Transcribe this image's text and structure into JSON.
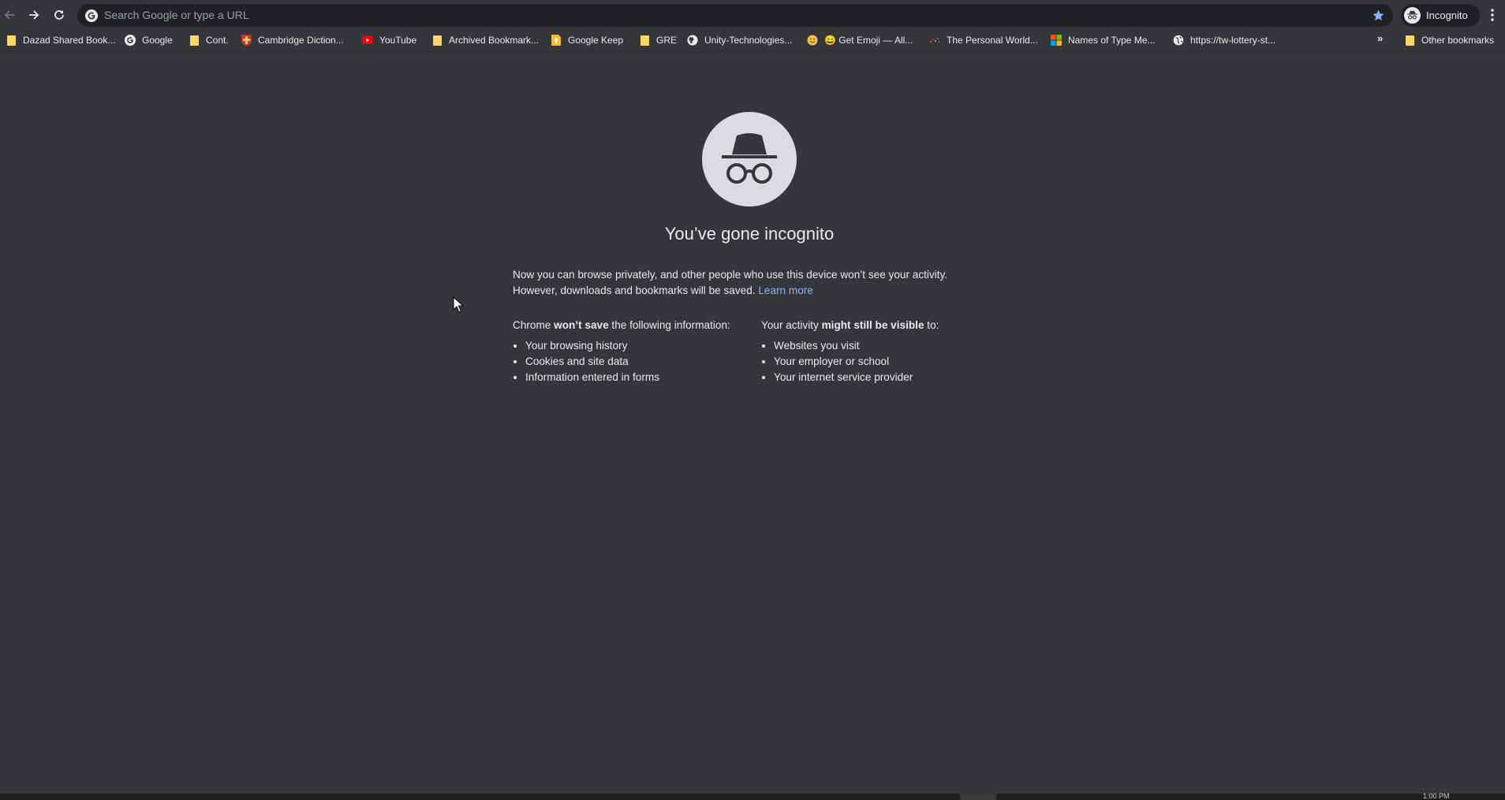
{
  "omnibox": {
    "placeholder": "Search Google or type a URL"
  },
  "profile": {
    "label": "Incognito"
  },
  "bookmarks": [
    {
      "label": "Dazad Shared Book...",
      "icon": "folder-icon"
    },
    {
      "label": "Google",
      "icon": "google-icon"
    },
    {
      "label": "Cont.",
      "icon": "folder-icon"
    },
    {
      "label": "Cambridge Diction...",
      "icon": "cambridge-icon"
    },
    {
      "label": "YouTube",
      "icon": "youtube-icon"
    },
    {
      "label": "Archived Bookmark...",
      "icon": "folder-icon"
    },
    {
      "label": "Google Keep",
      "icon": "google-keep-icon"
    },
    {
      "label": "GRE",
      "icon": "folder-icon"
    },
    {
      "label": "Unity-Technologies...",
      "icon": "github-icon"
    },
    {
      "label": "😄 Get Emoji — All...",
      "icon": "emoji-icon"
    },
    {
      "label": "The Personal World...",
      "icon": "personal-world-icon"
    },
    {
      "label": "Names of Type Me...",
      "icon": "microsoft-icon"
    },
    {
      "label": "https://tw-lottery-st...",
      "icon": "globe-icon"
    }
  ],
  "bookmarks_overflow": "»",
  "other_bookmarks": {
    "label": "Other bookmarks",
    "icon": "folder-icon"
  },
  "page": {
    "title": "You’ve gone incognito",
    "intro_line1": "Now you can browse privately, and other people who use this device won’t see your activity.",
    "intro_line2": "However, downloads and bookmarks will be saved.",
    "learn_more": "Learn more",
    "left": {
      "head_pre": "Chrome ",
      "head_bold": "won’t save",
      "head_post": " the following information:",
      "items": [
        "Your browsing history",
        "Cookies and site data",
        "Information entered in forms"
      ]
    },
    "right": {
      "head_pre": "Your activity ",
      "head_bold": "might still be visible",
      "head_post": " to:",
      "items": [
        "Websites you visit",
        "Your employer or school",
        "Your internet service provider"
      ]
    }
  },
  "taskbar": {
    "clock": "1:00 PM"
  },
  "colors": {
    "background": "#35363a",
    "omnibox": "#202124",
    "link": "#8ab4f8",
    "star": "#8ab4f8"
  }
}
